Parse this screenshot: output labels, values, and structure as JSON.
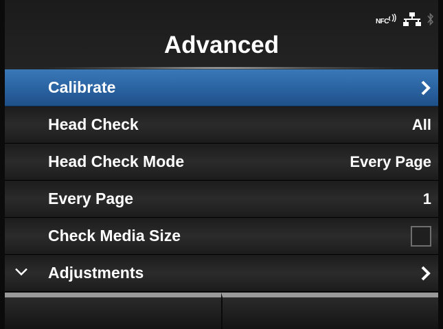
{
  "header": {
    "title": "Advanced",
    "status_icons": {
      "nfc_label": "NFC",
      "network": "network-icon",
      "bluetooth": "bluetooth-icon"
    }
  },
  "menu": {
    "items": [
      {
        "label": "Calibrate",
        "value": "",
        "control": "chevron-right-icon",
        "selected": true
      },
      {
        "label": "Head Check",
        "value": "All"
      },
      {
        "label": "Head Check Mode",
        "value": "Every Page"
      },
      {
        "label": "Every Page",
        "value": "1"
      },
      {
        "label": "Check Media Size",
        "control": "checkbox",
        "checked": false
      },
      {
        "label": "Adjustments",
        "control": "chevron-right-icon",
        "leading_icon": "chevron-down-icon"
      }
    ]
  },
  "softkeys": [
    {
      "label": ""
    },
    {
      "label": ""
    }
  ],
  "colors": {
    "selected_row": "#2b64a3",
    "row_background": "#1c1c1c",
    "text": "#ffffff"
  }
}
